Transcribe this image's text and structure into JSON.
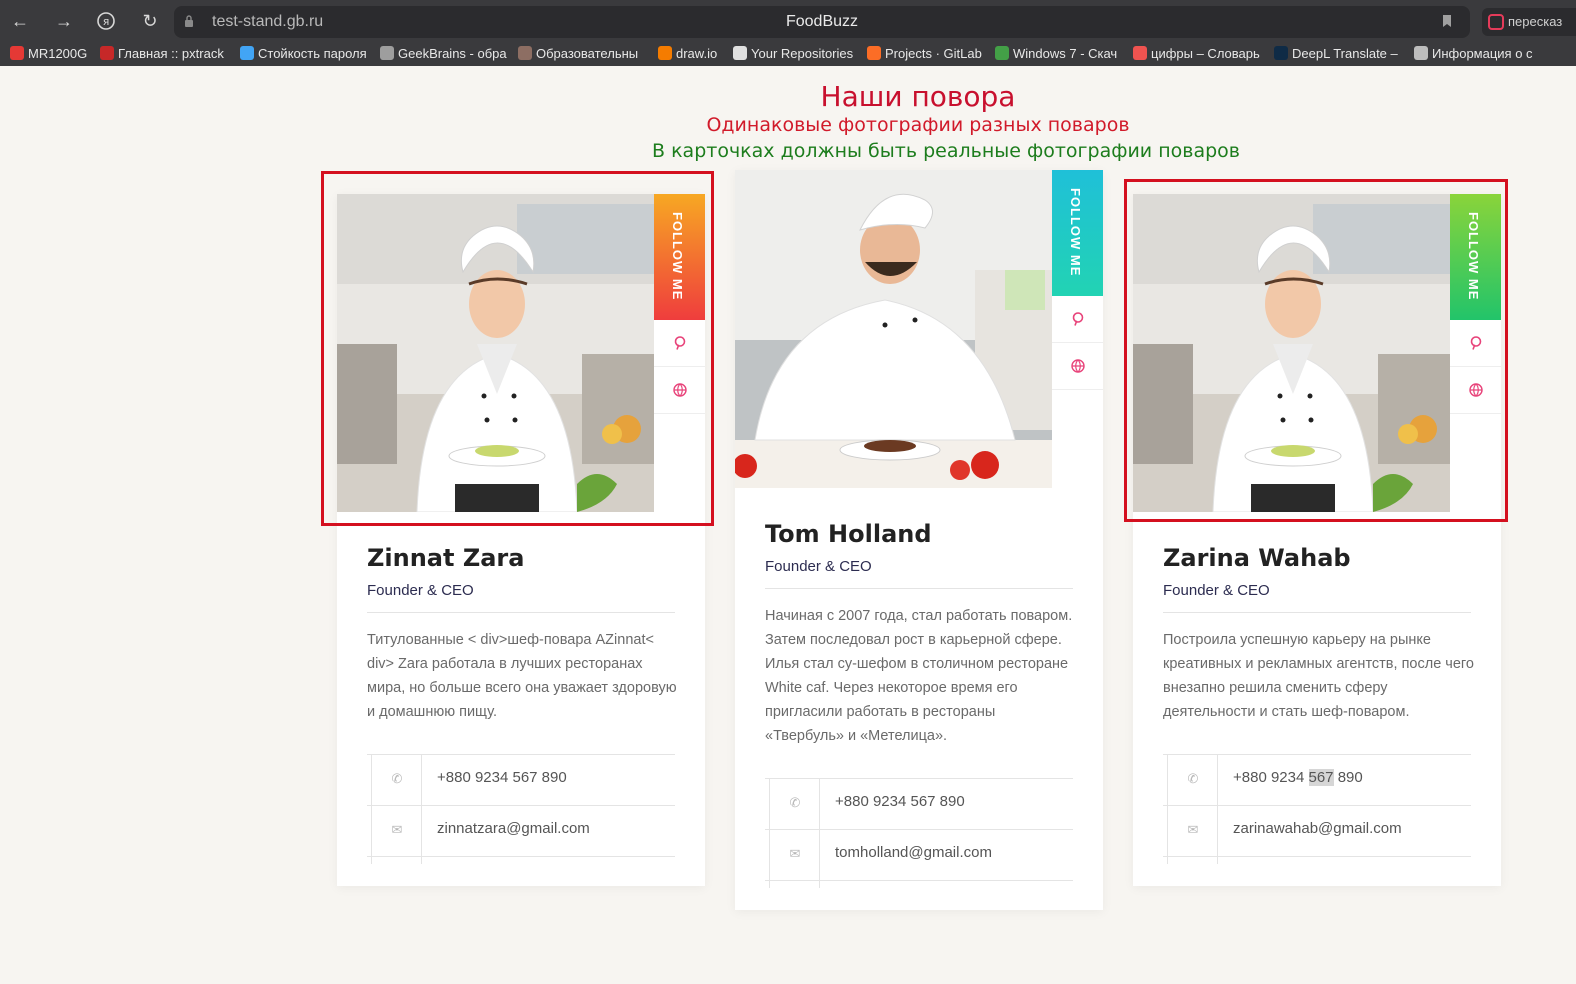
{
  "browser": {
    "url": "test-stand.gb.ru",
    "page_title": "FoodBuzz",
    "extension_label": "пересказ",
    "bookmarks": [
      {
        "label": "MR1200G",
        "color": "#e53935"
      },
      {
        "label": "Главная :: pxtrack",
        "color": "#c62828"
      },
      {
        "label": "Стойкость пароля",
        "color": "#42a5f5"
      },
      {
        "label": "GeekBrains - обра",
        "color": "#9e9e9e"
      },
      {
        "label": "Образовательны",
        "color": "#8d6e63"
      },
      {
        "label": "draw.io",
        "color": "#f57c00"
      },
      {
        "label": "Your Repositories",
        "color": "#e0e0e0"
      },
      {
        "label": "Projects · GitLab",
        "color": "#fc6d26"
      },
      {
        "label": "Windows 7 - Скач",
        "color": "#43a047"
      },
      {
        "label": "цифры – Словарь",
        "color": "#ef5350"
      },
      {
        "label": "DeepL Translate –",
        "color": "#0f2b46"
      },
      {
        "label": "Информация о с",
        "color": "#bdbdbd"
      }
    ]
  },
  "annotations": {
    "heading": "Наши повора",
    "note_red": "Одинаковые фотографии разных поваров",
    "note_green": "В карточках должны быть реальные фотографии поваров"
  },
  "cards": [
    {
      "name": "Zinnat Zara",
      "role": "Founder & CEO",
      "bio": "Титулованные < div>шеф-повара AZinnat< div> Zara работала в лучших ресторанах мира, но больше всего она уважает здоровую и домашнюю пищу.",
      "phone": "+880 9234 567 890",
      "email": "zinnatzara@gmail.com",
      "follow_label": "FOLLOW ME",
      "ribbon_colors": [
        "#f7a823",
        "#ef3d3d"
      ]
    },
    {
      "name": "Tom Holland",
      "role": "Founder & CEO",
      "bio": "Начиная с 2007 года, стал работать поваром. Затем последовал рост в карьерной сфере. Илья стал су-шефом в столичном ресторане White caf. Через некоторое время его пригласили работать в рестораны «Твербуль» и «Метелица».",
      "phone": "+880 9234 567 890",
      "email": "tomholland@gmail.com",
      "follow_label": "FOLLOW ME",
      "ribbon_colors": [
        "#1fc0d8",
        "#22d3b3"
      ]
    },
    {
      "name": "Zarina Wahab",
      "role": "Founder & CEO",
      "bio": "Построила успешную карьеру на рынке креативных и рекламных агентств, после чего внезапно решила сменить сферу деятельности и стать шеф-поваром.",
      "phone_parts": [
        "+880 9234 ",
        "567",
        " 890"
      ],
      "email": "zarinawahab@gmail.com",
      "follow_label": "FOLLOW ME",
      "ribbon_colors": [
        "#8ad43a",
        "#22c46a"
      ]
    }
  ]
}
